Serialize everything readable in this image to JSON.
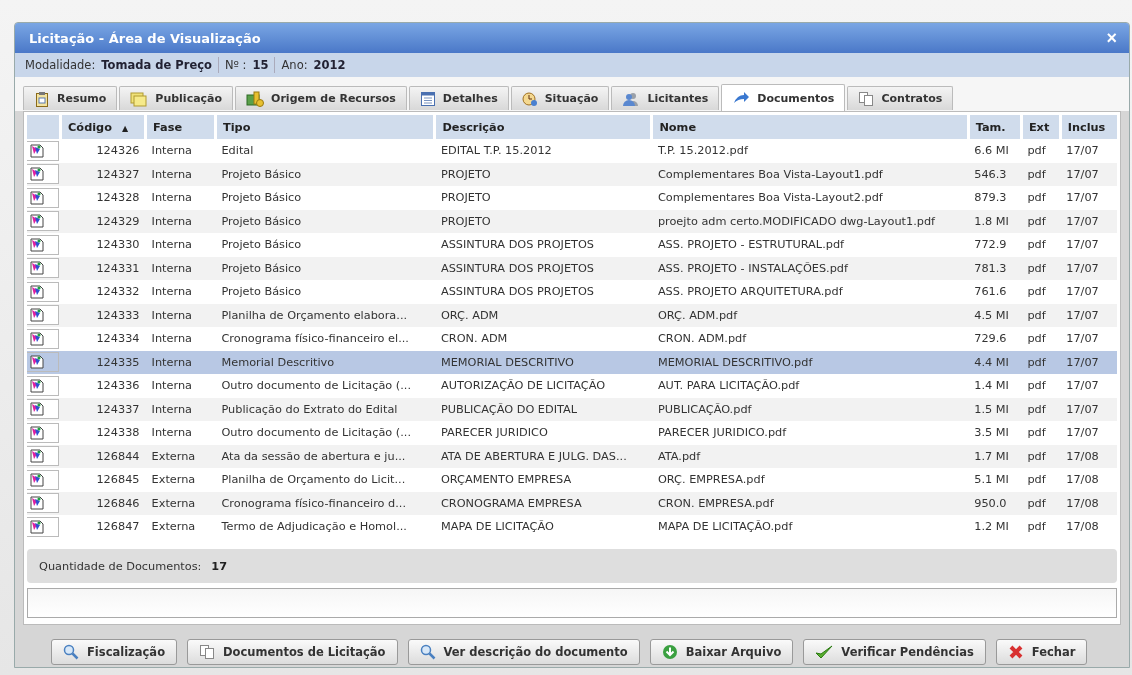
{
  "window": {
    "title": "Licitação - Área de Visualização",
    "close": "×"
  },
  "info": [
    {
      "label": "Modalidade:",
      "value": "Tomada de Preço"
    },
    {
      "label": "Nº :",
      "value": "15"
    },
    {
      "label": "Ano:",
      "value": "2012"
    }
  ],
  "tabs": [
    {
      "label": "Resumo",
      "kind": "clipboard",
      "selected": false
    },
    {
      "label": "Publicação",
      "kind": "notes",
      "selected": false
    },
    {
      "label": "Origem de Recursos",
      "kind": "money",
      "selected": false
    },
    {
      "label": "Detalhes",
      "kind": "list",
      "selected": false
    },
    {
      "label": "Situação",
      "kind": "clock",
      "selected": false
    },
    {
      "label": "Licitantes",
      "kind": "people",
      "selected": false
    },
    {
      "label": "Documentos",
      "kind": "arrow",
      "selected": true
    },
    {
      "label": "Contratos",
      "kind": "copy",
      "selected": false
    }
  ],
  "table": {
    "columns": [
      {
        "label": "Código",
        "sort_indicator": "▲"
      },
      {
        "label": "Fase"
      },
      {
        "label": "Tipo"
      },
      {
        "label": "Descrição"
      },
      {
        "label": "Nome"
      },
      {
        "label": "Tam."
      },
      {
        "label": "Ext"
      },
      {
        "label": "Inclus"
      }
    ],
    "rows": [
      {
        "cells": [
          "124326",
          "Interna",
          "Edital",
          "EDITAL T.P. 15.2012",
          "T.P. 15.2012.pdf",
          "6.6 MI",
          "pdf",
          "17/07"
        ],
        "selected": false
      },
      {
        "cells": [
          "124327",
          "Interna",
          "Projeto Básico",
          "PROJETO",
          "Complementares Boa Vista-Layout1.pdf",
          "546.3",
          "pdf",
          "17/07"
        ],
        "selected": false
      },
      {
        "cells": [
          "124328",
          "Interna",
          "Projeto Básico",
          "PROJETO",
          "Complementares Boa Vista-Layout2.pdf",
          "879.3",
          "pdf",
          "17/07"
        ],
        "selected": false
      },
      {
        "cells": [
          "124329",
          "Interna",
          "Projeto Básico",
          "PROJETO",
          "proejto adm certo.MODIFICADO dwg-Layout1.pdf",
          "1.8 MI",
          "pdf",
          "17/07"
        ],
        "selected": false
      },
      {
        "cells": [
          "124330",
          "Interna",
          "Projeto Básico",
          "ASSINTURA DOS PROJETOS",
          "ASS. PROJETO - ESTRUTURAL.pdf",
          "772.9",
          "pdf",
          "17/07"
        ],
        "selected": false
      },
      {
        "cells": [
          "124331",
          "Interna",
          "Projeto Básico",
          "ASSINTURA DOS PROJETOS",
          "ASS. PROJETO - INSTALAÇÕES.pdf",
          "781.3",
          "pdf",
          "17/07"
        ],
        "selected": false
      },
      {
        "cells": [
          "124332",
          "Interna",
          "Projeto Básico",
          "ASSINTURA DOS PROJETOS",
          "ASS. PROJETO ARQUITETURA.pdf",
          "761.6",
          "pdf",
          "17/07"
        ],
        "selected": false
      },
      {
        "cells": [
          "124333",
          "Interna",
          "Planilha de Orçamento elabora...",
          "ORÇ. ADM",
          "ORÇ. ADM.pdf",
          "4.5 MI",
          "pdf",
          "17/07"
        ],
        "selected": false
      },
      {
        "cells": [
          "124334",
          "Interna",
          "Cronograma físico-financeiro el...",
          "CRON. ADM",
          "CRON. ADM.pdf",
          "729.6",
          "pdf",
          "17/07"
        ],
        "selected": false
      },
      {
        "cells": [
          "124335",
          "Interna",
          "Memorial Descritivo",
          "MEMORIAL DESCRITIVO",
          "MEMORIAL DESCRITIVO.pdf",
          "4.4 MI",
          "pdf",
          "17/07"
        ],
        "selected": true
      },
      {
        "cells": [
          "124336",
          "Interna",
          "Outro documento de Licitação (...",
          "AUTORIZAÇÃO DE LICITAÇÃO",
          "AUT. PARA LICITAÇÃO.pdf",
          "1.4 MI",
          "pdf",
          "17/07"
        ],
        "selected": false
      },
      {
        "cells": [
          "124337",
          "Interna",
          "Publicação do Extrato do Edital",
          "PUBLICAÇÃO DO EDITAL",
          "PUBLICAÇÃO.pdf",
          "1.5 MI",
          "pdf",
          "17/07"
        ],
        "selected": false
      },
      {
        "cells": [
          "124338",
          "Interna",
          "Outro documento de Licitação (...",
          "PARECER JURIDICO",
          "PARECER JURIDICO.pdf",
          "3.5 MI",
          "pdf",
          "17/07"
        ],
        "selected": false
      },
      {
        "cells": [
          "126844",
          "Externa",
          "Ata da sessão de abertura e ju...",
          "ATA DE ABERTURA E JULG. DAS...",
          "ATA.pdf",
          "1.7 MI",
          "pdf",
          "17/08"
        ],
        "selected": false
      },
      {
        "cells": [
          "126845",
          "Externa",
          "Planilha de Orçamento do Licit...",
          "ORÇAMENTO EMPRESA",
          "ORÇ. EMPRESA.pdf",
          "5.1 MI",
          "pdf",
          "17/08"
        ],
        "selected": false
      },
      {
        "cells": [
          "126846",
          "Externa",
          "Cronograma físico-financeiro d...",
          "CRONOGRAMA EMPRESA",
          "CRON. EMPRESA.pdf",
          "950.0",
          "pdf",
          "17/08"
        ],
        "selected": false
      },
      {
        "cells": [
          "126847",
          "Externa",
          "Termo de Adjudicação e Homol...",
          "MAPA DE LICITAÇÃO",
          "MAPA DE LICITAÇÃO.pdf",
          "1.2 MI",
          "pdf",
          "17/08"
        ],
        "selected": false
      }
    ]
  },
  "summary": {
    "label": "Quantidade de Documentos:",
    "value": "17"
  },
  "buttons": [
    {
      "label": "Fiscalização",
      "kind": "search"
    },
    {
      "label": "Documentos de Licitação",
      "kind": "copy"
    },
    {
      "label": "Ver descrição do documento",
      "kind": "search"
    },
    {
      "label": "Baixar Arquivo",
      "kind": "download"
    },
    {
      "label": "Verificar Pendências",
      "kind": "check"
    },
    {
      "label": "Fechar",
      "kind": "close"
    }
  ]
}
